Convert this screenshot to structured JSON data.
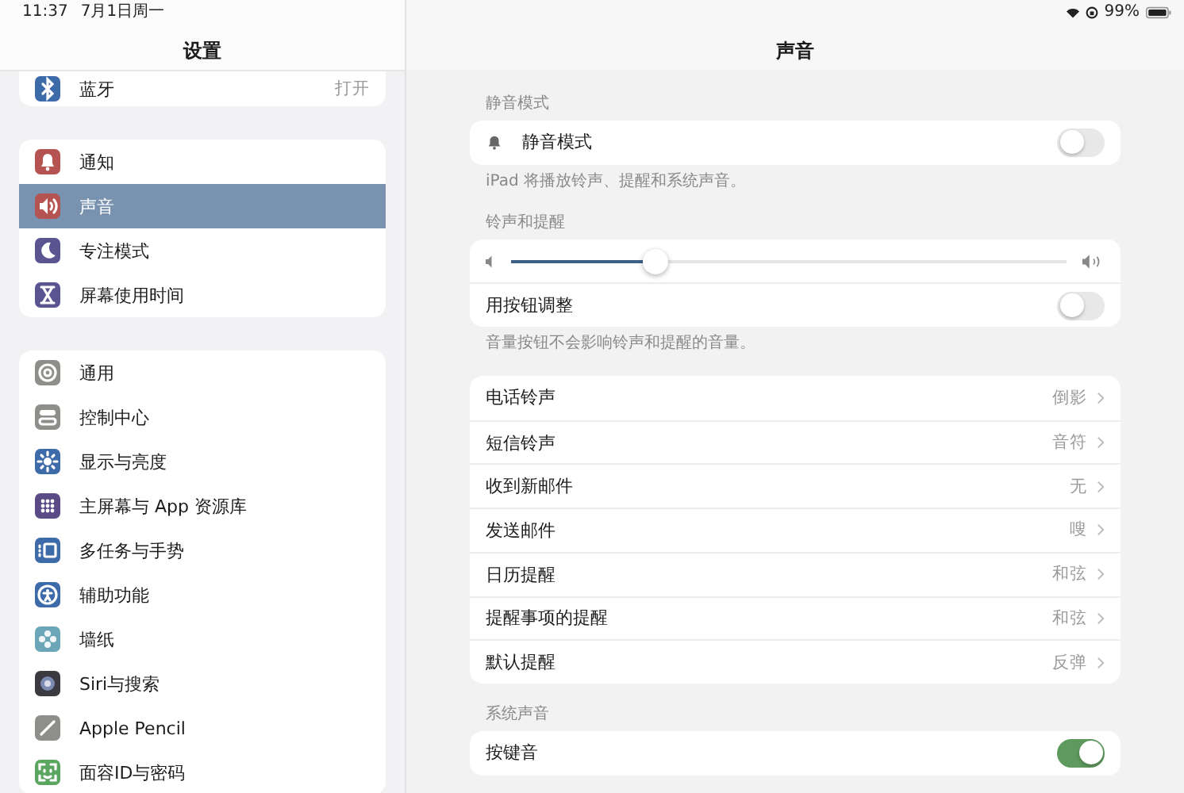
{
  "status_bar": {
    "time": "11:37",
    "date": "7月1日周一",
    "battery": "99%"
  },
  "sidebar": {
    "title": "设置",
    "groups": [
      {
        "items": [
          {
            "label": "蓝牙",
            "value": "打开",
            "color": "#3d6aa8",
            "selected": false
          }
        ]
      },
      {
        "items": [
          {
            "label": "通知",
            "color": "#b4534f",
            "selected": false
          },
          {
            "label": "声音",
            "color": "#b4534f",
            "selected": true
          },
          {
            "label": "专注模式",
            "color": "#5a5590",
            "selected": false
          },
          {
            "label": "屏幕使用时间",
            "color": "#5a5590",
            "selected": false
          }
        ]
      },
      {
        "items": [
          {
            "label": "通用",
            "color": "#8e8e8a",
            "selected": false
          },
          {
            "label": "控制中心",
            "color": "#8e8e8a",
            "selected": false
          },
          {
            "label": "显示与亮度",
            "color": "#3d6aa8",
            "selected": false
          },
          {
            "label": "主屏幕与 App 资源库",
            "color": "#5a4a85",
            "selected": false
          },
          {
            "label": "多任务与手势",
            "color": "#3d6aa8",
            "selected": false
          },
          {
            "label": "辅助功能",
            "color": "#3d6aa8",
            "selected": false
          },
          {
            "label": "墙纸",
            "color": "#6aa5b8",
            "selected": false
          },
          {
            "label": "Siri与搜索",
            "color": "#3a3a40",
            "selected": false
          },
          {
            "label": "Apple Pencil",
            "color": "#8e8e8a",
            "selected": false
          },
          {
            "label": "面容ID与密码",
            "color": "#5aa560",
            "selected": false
          }
        ]
      }
    ]
  },
  "detail": {
    "title": "声音",
    "sections": [
      {
        "label": "静音模式",
        "rows": [
          {
            "kind": "toggle",
            "label": "静音模式",
            "bell": true,
            "on": false
          }
        ],
        "footer": "iPad 将播放铃声、提醒和系统声音。"
      },
      {
        "label": "铃声和提醒",
        "rows": [
          {
            "kind": "slider",
            "level": 0.26
          },
          {
            "kind": "toggle",
            "label": "用按钮调整",
            "on": false
          }
        ],
        "footer": "音量按钮不会影响铃声和提醒的音量。"
      },
      {
        "rows": [
          {
            "kind": "link",
            "label": "电话铃声",
            "value": "倒影"
          },
          {
            "kind": "link",
            "label": "短信铃声",
            "value": "音符"
          },
          {
            "kind": "link",
            "label": "收到新邮件",
            "value": "无"
          },
          {
            "kind": "link",
            "label": "发送邮件",
            "value": "嗖"
          },
          {
            "kind": "link",
            "label": "日历提醒",
            "value": "和弦"
          },
          {
            "kind": "link",
            "label": "提醒事项的提醒",
            "value": "和弦"
          },
          {
            "kind": "link",
            "label": "默认提醒",
            "value": "反弹"
          }
        ]
      },
      {
        "label": "系统声音",
        "rows": [
          {
            "kind": "toggle",
            "label": "按键音",
            "on": true
          }
        ]
      }
    ]
  }
}
